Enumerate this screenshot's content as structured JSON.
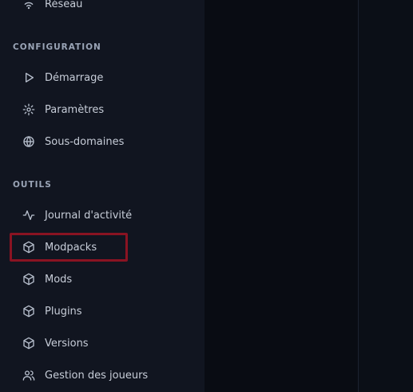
{
  "sidebar": {
    "top_item": {
      "label": "Réseau",
      "icon": "wifi-icon"
    },
    "sections": [
      {
        "title": "CONFIGURATION",
        "items": [
          {
            "label": "Démarrage",
            "icon": "play-icon"
          },
          {
            "label": "Paramètres",
            "icon": "gear-icon"
          },
          {
            "label": "Sous-domaines",
            "icon": "globe-icon"
          }
        ]
      },
      {
        "title": "OUTILS",
        "items": [
          {
            "label": "Journal d'activité",
            "icon": "activity-icon"
          },
          {
            "label": "Modpacks",
            "icon": "package-icon",
            "highlighted": true
          },
          {
            "label": "Mods",
            "icon": "package-icon"
          },
          {
            "label": "Plugins",
            "icon": "package-icon"
          },
          {
            "label": "Versions",
            "icon": "package-icon"
          },
          {
            "label": "Gestion des joueurs",
            "icon": "users-icon"
          }
        ]
      }
    ]
  },
  "colors": {
    "sidebar_bg": "#111520",
    "main_bg": "#090c13",
    "highlight_border": "#8a1322",
    "text": "#c7cdd8"
  }
}
